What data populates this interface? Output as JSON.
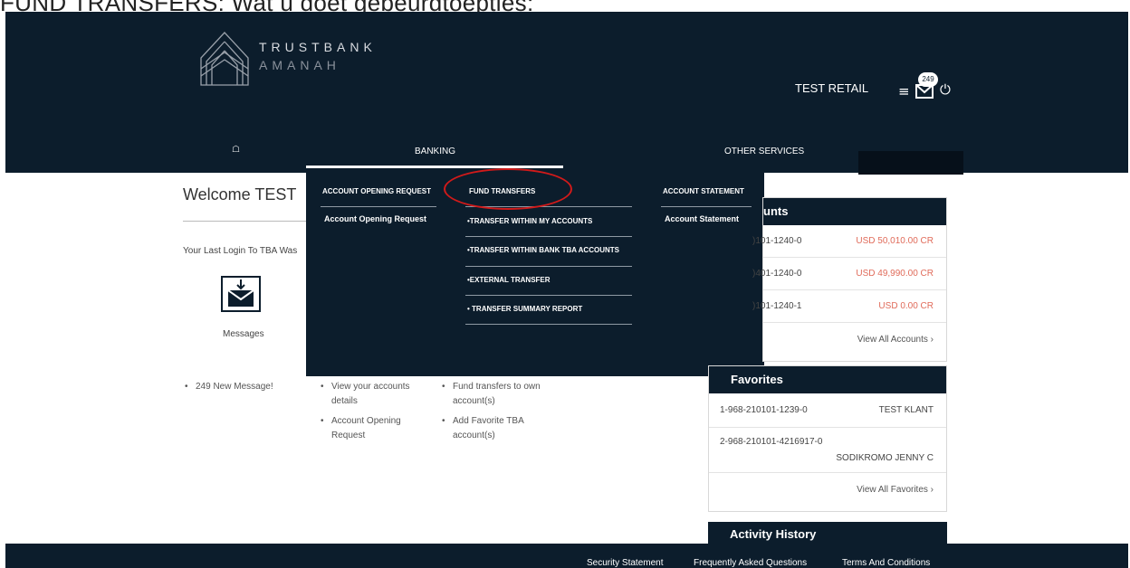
{
  "caption": "FUND TRANSFERS: Wat u doet gebeurdtoepties:",
  "header": {
    "brand_line1": "TRUSTBANK",
    "brand_line2": "AMANAH",
    "user": "TEST RETAIL",
    "mail_count": "249"
  },
  "nav": {
    "home_icon": "home-icon",
    "banking": "BANKING",
    "other": "OTHER SERVICES"
  },
  "welcome": {
    "title": "Welcome TEST",
    "last_login": "Your Last Login To TBA Was"
  },
  "messages": {
    "label": "Messages",
    "new": "249 New Message!"
  },
  "accounts_list": [
    "View your accounts details",
    "Account Opening Request"
  ],
  "transfers_list": [
    "Fund transfers to own account(s)",
    "Add Favorite TBA account(s)"
  ],
  "dropdown": {
    "col1": {
      "heading": "ACCOUNT OPENING REQUEST",
      "item": "Account Opening Request"
    },
    "col2": {
      "heading": "FUND TRANSFERS",
      "items": [
        "•TRANSFER WITHIN MY ACCOUNTS",
        "•TRANSFER WITHIN BANK TBA ACCOUNTS",
        "•EXTERNAL TRANSFER",
        "• TRANSFER SUMMARY REPORT"
      ]
    },
    "col3": {
      "heading": "ACCOUNT STATEMENT",
      "item": "Account Statement"
    }
  },
  "accounts_panel": {
    "title": "unts",
    "rows": [
      {
        "account": ")101-1240-0",
        "balance": "USD 50,010.00 CR"
      },
      {
        "account": ")401-1240-0",
        "balance": "USD 49,990.00 CR"
      },
      {
        "account": ")101-1240-1",
        "balance": "USD 0.00 CR"
      }
    ],
    "view_all": "View All Accounts ›"
  },
  "favorites_panel": {
    "title": "Favorites",
    "rows": [
      {
        "account": "1-968-210101-1239-0",
        "name": "TEST KLANT"
      },
      {
        "account": "2-968-210101-4216917-0",
        "name": "SODIKROMO JENNY C"
      }
    ],
    "view_all": "View All Favorites ›"
  },
  "activity_panel": {
    "title": "Activity History"
  },
  "footer": {
    "security": "Security Statement",
    "faq": "Frequently Asked Questions",
    "terms": "Terms And Conditions"
  },
  "colors": {
    "navy": "#0c1d2c",
    "balance_red": "#e06b5a",
    "highlight": "#d11a1a"
  }
}
